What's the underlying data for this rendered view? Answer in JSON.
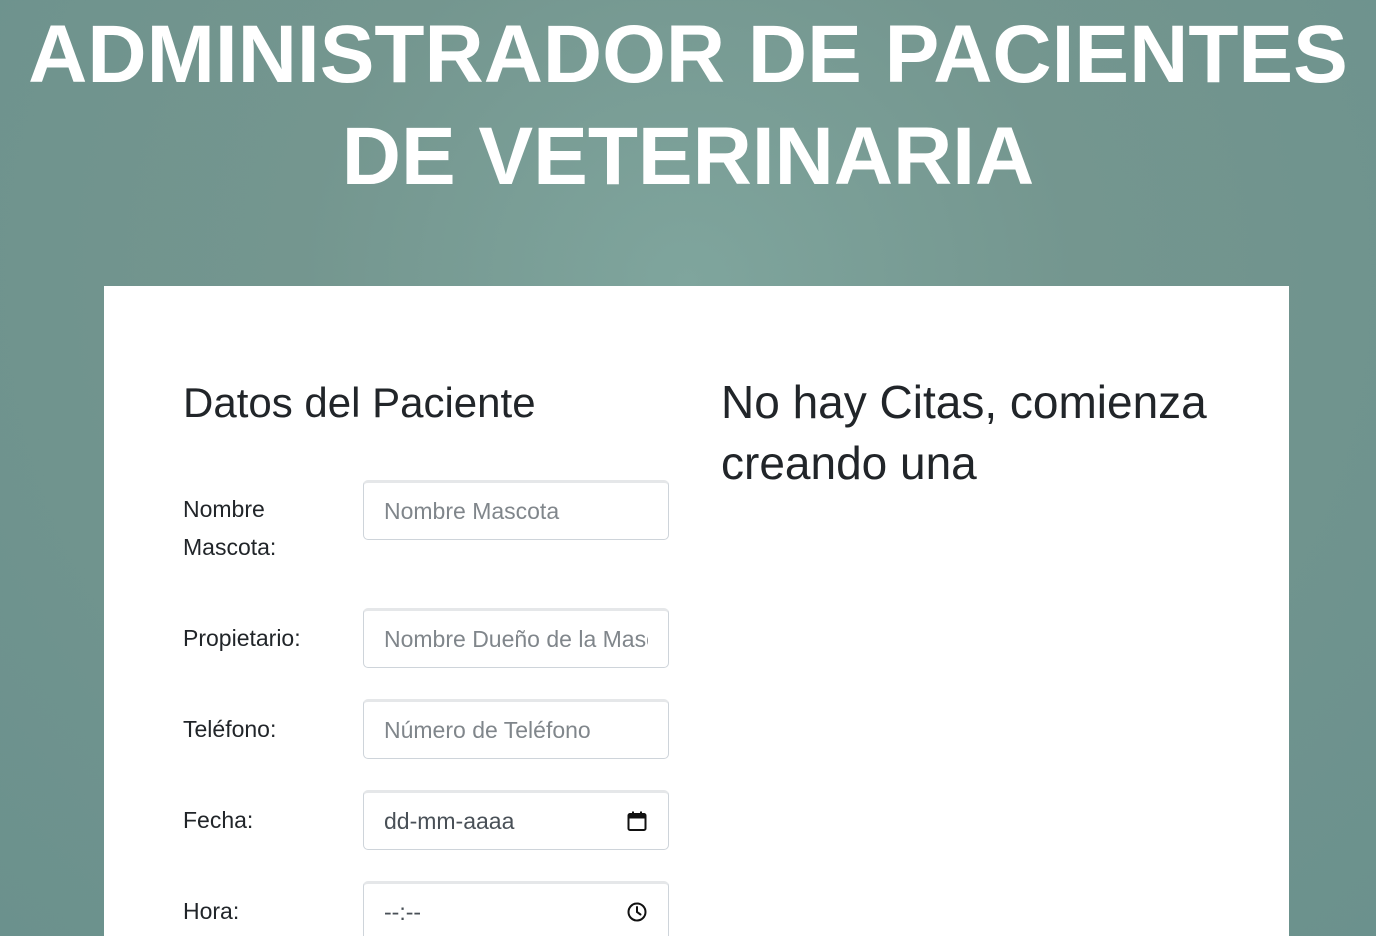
{
  "header": {
    "title_line1": "ADMINISTRADOR DE PACIENTES",
    "title_line2": "DE VETERINARIA"
  },
  "form": {
    "title": "Datos del Paciente",
    "fields": {
      "mascota": {
        "label_line1": "Nombre",
        "label_line2": "Mascota:",
        "placeholder": "Nombre Mascota"
      },
      "propietario": {
        "label": "Propietario:",
        "placeholder": "Nombre Dueño de la Mascota"
      },
      "telefono": {
        "label": "Teléfono:",
        "placeholder": "Número de Teléfono"
      },
      "fecha": {
        "label": "Fecha:",
        "value": "dd-mm-aaaa",
        "icon": "calendar-icon"
      },
      "hora": {
        "label": "Hora:",
        "value": "--:--",
        "icon": "clock-icon"
      }
    }
  },
  "appointments": {
    "empty_message": "No hay Citas, comienza creando una"
  },
  "colors": {
    "background": "#74968f",
    "card": "#ffffff",
    "text": "#212529",
    "title": "#ffffff"
  }
}
